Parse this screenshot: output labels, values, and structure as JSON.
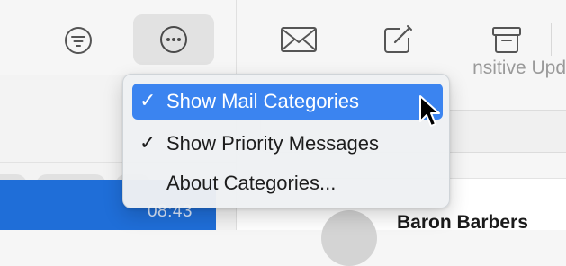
{
  "toolbar": {
    "icons": [
      "filter-icon",
      "more-icon",
      "envelope-icon",
      "compose-icon",
      "archive-icon"
    ]
  },
  "message_list": {
    "selected_time": "08:43"
  },
  "content": {
    "search_text": "nsitive Upd",
    "sender": "Baron Barbers"
  },
  "menu": {
    "items": [
      {
        "label": "Show Mail Categories",
        "checked": true,
        "highlighted": true,
        "check": "✓"
      },
      {
        "label": "Show Priority Messages",
        "checked": true,
        "highlighted": false,
        "check": "✓"
      },
      {
        "label": "About Categories...",
        "checked": false,
        "highlighted": false,
        "check": ""
      }
    ]
  },
  "colors": {
    "accent": "#3b84f0",
    "selected_row": "#1f6ed8"
  }
}
